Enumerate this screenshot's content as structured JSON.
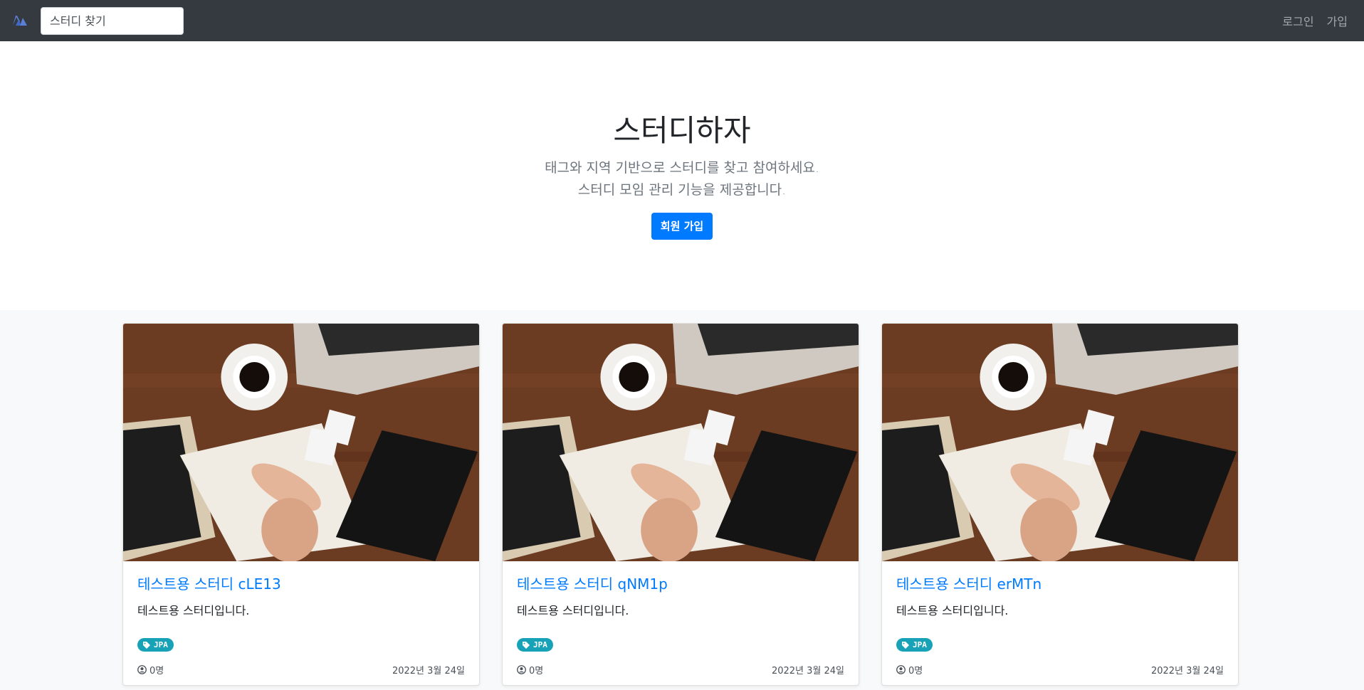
{
  "navbar": {
    "search_placeholder": "스터디 찾기",
    "login": "로그인",
    "signup": "가입"
  },
  "hero": {
    "title": "스터디하자",
    "lead_line1": "태그와 지역 기반으로 스터디를 찾고 참여하세요.",
    "lead_line2": "스터디 모임 관리 기능을 제공합니다.",
    "signup_button": "회원 가입"
  },
  "studies": [
    {
      "title": "테스트용 스터디 cLE13",
      "description": "테스트용 스터디입니다.",
      "tag": "JPA",
      "members": "0명",
      "date": "2022년 3월 24일"
    },
    {
      "title": "테스트용 스터디 qNM1p",
      "description": "테스트용 스터디입니다.",
      "tag": "JPA",
      "members": "0명",
      "date": "2022년 3월 24일"
    },
    {
      "title": "테스트용 스터디 erMTn",
      "description": "테스트용 스터디입니다.",
      "tag": "JPA",
      "members": "0명",
      "date": "2022년 3월 24일"
    }
  ],
  "colors": {
    "navbar": "#343a40",
    "primary": "#007bff",
    "tag": "#17a2b8",
    "section_bg": "#f8f9fa"
  }
}
